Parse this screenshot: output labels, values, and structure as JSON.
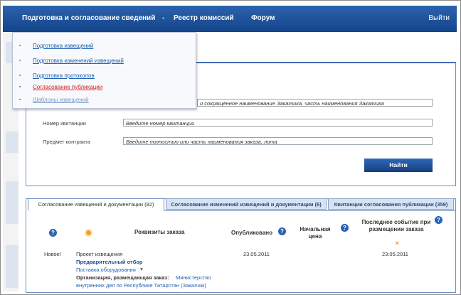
{
  "topnav": {
    "items": [
      "Подготовка и согласование сведений",
      "Реестр комиссий",
      "Форум"
    ],
    "separator": "-",
    "exit": "Выйти"
  },
  "dropdown": {
    "items": [
      {
        "label": "Подготовка извещений",
        "state": "link"
      },
      {
        "label": "Подготовка изменений извещений",
        "state": "link"
      },
      {
        "label": "Подготовка протоколов",
        "state": "link"
      },
      {
        "label": "Согласование публикации",
        "state": "active"
      },
      {
        "label": "Шаблоны извещений",
        "state": "muted"
      }
    ]
  },
  "search": {
    "customer_placeholder": "и сокращённое наименование Заказчика, часть наименования Заказчика",
    "receipt_label": "Номер квитанции",
    "receipt_placeholder": "Введите номер квитанции",
    "subject_label": "Предмет контракта",
    "subject_placeholder": "Введите полностью или часть наименования заказа, лота",
    "find_button": "Найти"
  },
  "tabs": [
    {
      "label": "Согласование извещений и документации (82)",
      "active": true
    },
    {
      "label": "Согласование изменений извещений и документации (6)",
      "active": false
    },
    {
      "label": "Квитанции согласования публикации (359)",
      "active": false
    }
  ],
  "table": {
    "headers": {
      "requisites": "Реквизиты заказа",
      "published": "Опубликовано",
      "price": "Начальная цена",
      "last_event": "Последнее событие при размещении заказа"
    },
    "row": {
      "status": "Новое!",
      "doc_type": "Проект извещения",
      "method": "Предварительный отбор",
      "subject": "Поставка оборудования",
      "org_label": "Организация, размещающая заказ:",
      "org_value_1": "Министерство",
      "org_value_2": "внутренних дел по Республике Татарстан (Заказчик)",
      "published_date": "23.05.2011",
      "last_event_date": "23.05.2011"
    }
  },
  "colors": {
    "topbar": "#1c4f96",
    "link": "#1f5fb0",
    "active_link": "#cc2222",
    "accent_icon": "#f1a22a"
  }
}
